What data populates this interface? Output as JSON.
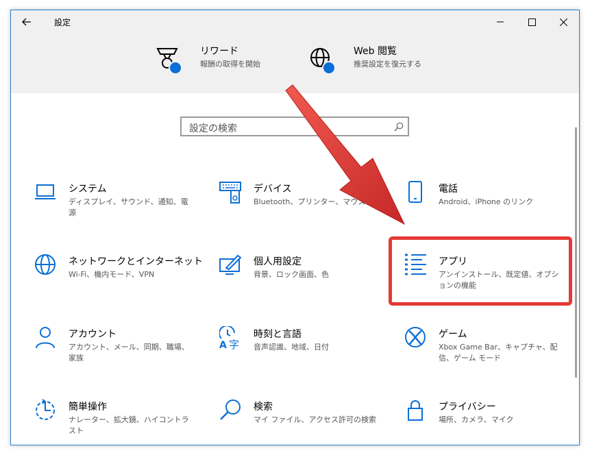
{
  "window": {
    "title": "設定"
  },
  "header_items": [
    {
      "title": "リワード",
      "subtitle": "報酬の取得を開始",
      "icon": "rewards-icon"
    },
    {
      "title": "Web 閲覧",
      "subtitle": "推奨設定を復元する",
      "icon": "globe-icon"
    }
  ],
  "search": {
    "placeholder": "設定の検索"
  },
  "tiles": [
    {
      "name": "システム",
      "desc": "ディスプレイ、サウンド、通知、電源",
      "icon": "laptop-icon"
    },
    {
      "name": "デバイス",
      "desc": "Bluetooth、プリンター、マウス",
      "icon": "keyboard-speaker-icon"
    },
    {
      "name": "電話",
      "desc": "Android、iPhone のリンク",
      "icon": "phone-icon"
    },
    {
      "name": "ネットワークとインターネット",
      "desc": "Wi-Fi、機内モード、VPN",
      "icon": "globe-icon"
    },
    {
      "name": "個人用設定",
      "desc": "背景、ロック画面、色",
      "icon": "paint-monitor-icon"
    },
    {
      "name": "アプリ",
      "desc": "アンインストール、既定値、オプションの機能",
      "icon": "apps-list-icon"
    },
    {
      "name": "アカウント",
      "desc": "アカウント、メール、同期、職場、家族",
      "icon": "person-icon"
    },
    {
      "name": "時刻と言語",
      "desc": "音声認識、地域、日付",
      "icon": "time-language-icon"
    },
    {
      "name": "ゲーム",
      "desc": "Xbox Game Bar、キャプチャ、配信、ゲーム モード",
      "icon": "xbox-icon"
    },
    {
      "name": "簡単操作",
      "desc": "ナレーター、拡大鏡、ハイコントラスト",
      "icon": "ease-of-access-icon"
    },
    {
      "name": "検索",
      "desc": "マイ ファイル、アクセス許可の検索",
      "icon": "search-icon"
    },
    {
      "name": "プライバシー",
      "desc": "場所、カメラ、マイク",
      "icon": "lock-icon"
    }
  ],
  "colors": {
    "accent": "#0a6fd6",
    "highlight": "#e53935",
    "arrow": "#d32f2f"
  }
}
